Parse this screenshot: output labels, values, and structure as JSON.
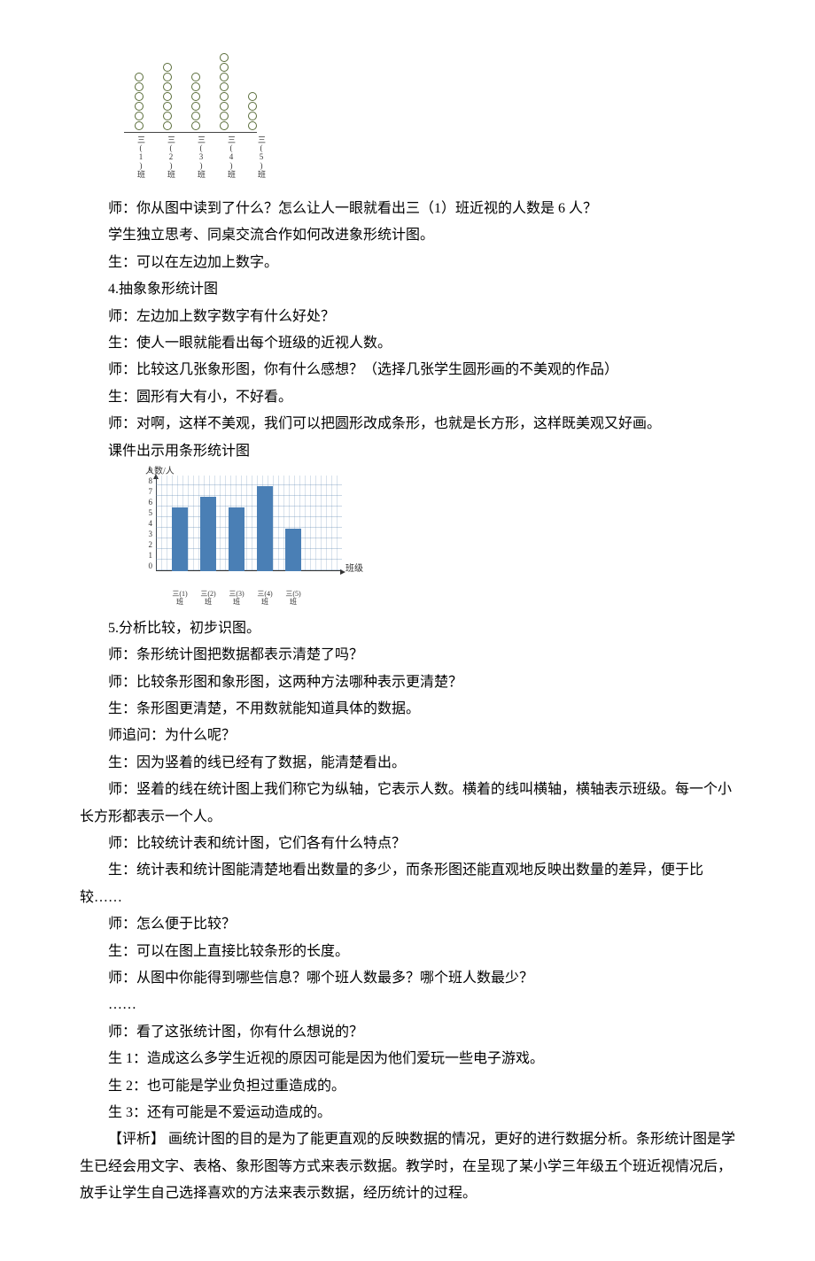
{
  "pictograph": {
    "categories": [
      "三(1)班",
      "三(2)班",
      "三(3)班",
      "三(4)班",
      "三(5)班"
    ],
    "values": [
      6,
      7,
      6,
      8,
      4
    ]
  },
  "lines": {
    "l1": "师：你从图中读到了什么？怎么让人一眼就看出三（1）班近视的人数是 6 人？",
    "l2": "学生独立思考、同桌交流合作如何改进象形统计图。",
    "l3": "生：可以在左边加上数字。",
    "l4": "4.抽象象形统计图",
    "l5": "师：左边加上数字数字有什么好处？",
    "l6": "生：使人一眼就能看出每个班级的近视人数。",
    "l7": "师：比较这几张象形图，你有什么感想？（选择几张学生圆形画的不美观的作品）",
    "l8": "生：圆形有大有小，不好看。",
    "l9": "师：对啊，这样不美观，我们可以把圆形改成条形，也就是长方形，这样既美观又好画。",
    "l10": "课件出示用条形统计图",
    "s5_title": "5.分析比较，初步识图。",
    "s5_1": "师：条形统计图把数据都表示清楚了吗？",
    "s5_2": "师：比较条形图和象形图，这两种方法哪种表示更清楚？",
    "s5_3": "生：条形图更清楚，不用数就能知道具体的数据。",
    "s5_4": "师追问：为什么呢？",
    "s5_5": "生：因为竖着的线已经有了数据，能清楚看出。",
    "s5_6": "师：竖着的线在统计图上我们称它为纵轴，它表示人数。横着的线叫横轴，横轴表示班级。每一个小长方形都表示一个人。",
    "s5_7": "师：比较统计表和统计图，它们各有什么特点？",
    "s5_8": "生：统计表和统计图能清楚地看出数量的多少，而条形图还能直观地反映出数量的差异，便于比较……",
    "s5_9": "师：怎么便于比较？",
    "s5_10": "生：可以在图上直接比较条形的长度。",
    "s5_11": "师：从图中你能得到哪些信息？哪个班人数最多？哪个班人数最少？",
    "s5_12": "……",
    "s5_13": "师：看了这张统计图，你有什么想说的？",
    "s5_14": "生 1：造成这么多学生近视的原因可能是因为他们爱玩一些电子游戏。",
    "s5_15": "生 2：也可能是学业负担过重造成的。",
    "s5_16": "生 3：还有可能是不爱运动造成的。",
    "commentary": "【评析】 画统计图的目的是为了能更直观的反映数据的情况，更好的进行数据分析。条形统计图是学生已经会用文字、表格、象形图等方式来表示数据。教学时，在呈现了某小学三年级五个班近视情况后，放手让学生自己选择喜欢的方法来表示数据，经历统计的过程。"
  },
  "chart_data": {
    "type": "bar",
    "title": "",
    "ylabel": "人数/人",
    "xlabel": "班级",
    "categories": [
      "三(1)班",
      "三(2)班",
      "三(3)班",
      "三(4)班",
      "三(5)班"
    ],
    "values": [
      6,
      7,
      6,
      8,
      4
    ],
    "ylim": [
      0,
      9
    ],
    "y_ticks": [
      0,
      1,
      2,
      3,
      4,
      5,
      6,
      7,
      8,
      9
    ]
  }
}
